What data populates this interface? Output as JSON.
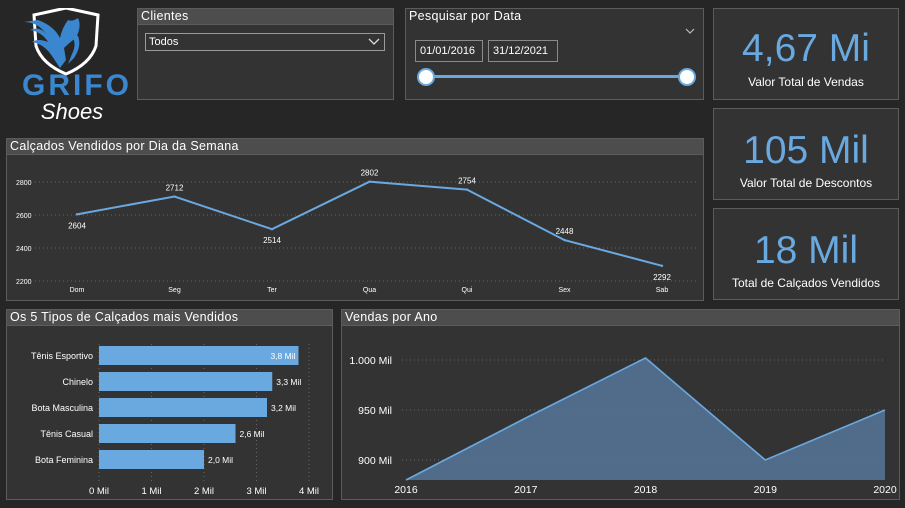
{
  "brand": {
    "name": "GRIFO",
    "sub": "Shoes"
  },
  "filters": {
    "clientes": {
      "title": "Clientes",
      "value": "Todos"
    },
    "data": {
      "title": "Pesquisar por Data",
      "start": "01/01/2016",
      "end": "31/12/2021"
    }
  },
  "kpis": [
    {
      "value": "4,67 Mi",
      "label": "Valor Total de Vendas"
    },
    {
      "value": "105 Mil",
      "label": "Valor Total de Descontos"
    },
    {
      "value": "18 Mil",
      "label": "Total de Calçados Vendidos"
    }
  ],
  "colors": {
    "accent": "#6aa9e0",
    "background": "#262626",
    "panel": "#333333"
  },
  "chart_data": [
    {
      "type": "line",
      "title": "Calçados Vendidos por Dia da Semana",
      "categories": [
        "Dom",
        "Seg",
        "Ter",
        "Qua",
        "Qui",
        "Sex",
        "Sab"
      ],
      "values": [
        2604,
        2712,
        2514,
        2802,
        2754,
        2448,
        2292
      ],
      "data_labels": [
        "2604",
        "2712",
        "2514",
        "2802",
        "2754",
        "2448",
        "2292"
      ],
      "yticks": [
        "2800",
        "2600",
        "2400",
        "2200"
      ],
      "ylim": [
        2200,
        2800
      ],
      "grid": true
    },
    {
      "type": "bar",
      "orientation": "horizontal",
      "title": "Os 5 Tipos de Calçados mais Vendidos",
      "categories": [
        "Tênis Esportivo",
        "Chinelo",
        "Bota Masculina",
        "Tênis Casual",
        "Bota Feminina"
      ],
      "values": [
        3.8,
        3.3,
        3.2,
        2.6,
        2.0
      ],
      "data_labels": [
        "3,8 Mil",
        "3,3 Mil",
        "3,2 Mil",
        "2,6 Mil",
        "2,0 Mil"
      ],
      "xticks": [
        "0 Mil",
        "1 Mil",
        "2 Mil",
        "3 Mil",
        "4 Mil"
      ],
      "xlim": [
        0,
        4
      ],
      "grid": true
    },
    {
      "type": "area",
      "title": "Vendas por Ano",
      "x": [
        "2016",
        "2017",
        "2018",
        "2019",
        "2020"
      ],
      "values": [
        880,
        942,
        1002,
        900,
        950
      ],
      "yticks": [
        "1.000 Mil",
        "950 Mil",
        "900 Mil"
      ],
      "ylim": [
        880,
        1010
      ],
      "grid": true
    }
  ]
}
